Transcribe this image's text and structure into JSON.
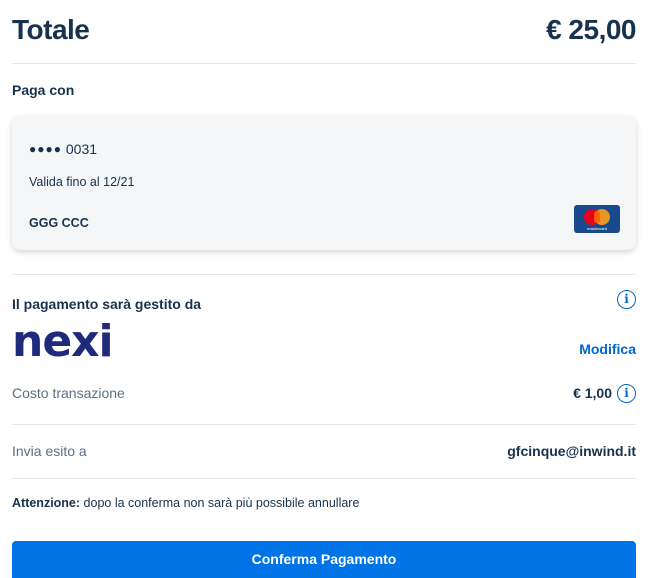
{
  "summary": {
    "total_label": "Totale",
    "total_amount": "€ 25,00"
  },
  "payment_method": {
    "heading": "Paga con",
    "card_dots": "●●●●",
    "card_last4": "0031",
    "valid_until": "Valida fino al 12/21",
    "holder": "GGG CCC",
    "card_brand_icon": "mastercard-icon",
    "card_brand_text": "mastercard"
  },
  "gateway": {
    "heading": "Il pagamento sarà gestito da",
    "logo_text": "nexi",
    "edit_label": "Modifica",
    "info_icon": "info-icon"
  },
  "fees": {
    "label": "Costo transazione",
    "value": "€ 1,00"
  },
  "receipt": {
    "label": "Invia esito a",
    "email": "gfcinque@inwind.it"
  },
  "notice": {
    "bold": "Attenzione:",
    "text": " dopo la conferma non sarà più possibile annullare"
  },
  "actions": {
    "confirm_label": "Conferma Pagamento"
  },
  "colors": {
    "primary": "#0066cc",
    "button": "#0073e6",
    "text": "#17324d",
    "muted": "#5c6f82",
    "nexi": "#1f2a7a"
  }
}
